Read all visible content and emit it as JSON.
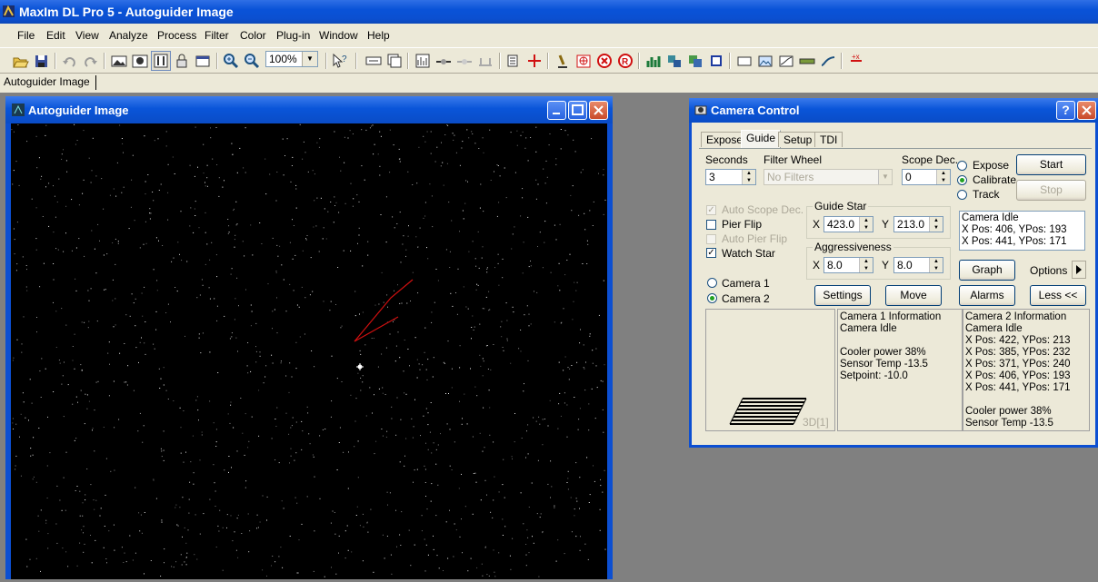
{
  "app": {
    "title": "MaxIm DL Pro 5 - Autoguider Image"
  },
  "menu": [
    "File",
    "Edit",
    "View",
    "Analyze",
    "Process",
    "Filter",
    "Color",
    "Plug-in",
    "Window",
    "Help"
  ],
  "toolbar": {
    "zoom_value": "100%",
    "icons": [
      "open-icon",
      "save-icon",
      "undo-icon",
      "redo-icon",
      "image-icon",
      "screen-stretch-icon",
      "autoguider-icon",
      "lock-icon",
      "settings-icon",
      "zoom-in-icon",
      "zoom-out-icon",
      "help-pointer-icon",
      "info-icon",
      "stack-icon",
      "histogram-icon",
      "line-profile-icon",
      "graph-icon",
      "measure-icon",
      "copy-icon",
      "crosshair-icon",
      "telescope-icon",
      "camera-icon",
      "stop-icon",
      "record-icon",
      "bar-chart-icon",
      "layers-icon",
      "overlay-icon",
      "frame-icon",
      "rect-icon",
      "photo-icon",
      "curve-icon",
      "filter-icon",
      "line-icon",
      "marker-icon"
    ]
  },
  "tabs": [
    "Autoguider Image"
  ],
  "image_window": {
    "title": "Autoguider Image"
  },
  "camera_control": {
    "title": "Camera Control",
    "tabs": [
      "Expose",
      "Guide",
      "Setup",
      "TDI"
    ],
    "active_tab": "Guide",
    "seconds_label": "Seconds",
    "seconds_value": "3",
    "filter_wheel_label": "Filter Wheel",
    "filter_wheel_value": "No Filters",
    "scope_dec_label": "Scope Dec.",
    "scope_dec_value": "0",
    "mode_options": [
      "Expose",
      "Calibrate",
      "Track"
    ],
    "mode_selected": "Calibrate",
    "start_label": "Start",
    "stop_label": "Stop",
    "auto_scope_dec": "Auto Scope Dec.",
    "pier_flip": "Pier Flip",
    "auto_pier_flip": "Auto Pier Flip",
    "watch_star": "Watch Star",
    "guide_star_label": "Guide Star",
    "guide_x_label": "X",
    "guide_x_value": "423.0",
    "guide_y_label": "Y",
    "guide_y_value": "213.0",
    "aggressiveness_label": "Aggressiveness",
    "aggr_x_label": "X",
    "aggr_x_value": "8.0",
    "aggr_y_label": "Y",
    "aggr_y_value": "8.0",
    "status_lines": [
      "Camera Idle",
      "X Pos: 406, YPos: 193",
      "X Pos: 441, YPos: 171"
    ],
    "camera1": "Camera 1",
    "camera2": "Camera 2",
    "camera_selected": "Camera 2",
    "settings_label": "Settings",
    "move_label": "Move",
    "graph_label": "Graph",
    "options_label": "Options",
    "alarms_label": "Alarms",
    "less_label": "Less <<",
    "preview_label": "3D[1]",
    "cam1_info": [
      "Camera 1 Information",
      "Camera Idle",
      "",
      "Cooler power 38%",
      "Sensor Temp -13.5",
      "Setpoint: -10.0"
    ],
    "cam2_info": [
      "Camera 2 Information",
      "Camera Idle",
      "X Pos: 422, YPos: 213",
      "X Pos: 385, YPos: 232",
      "X Pos: 371, YPos: 240",
      "X Pos: 406, YPos: 193",
      "X Pos: 441, YPos: 171",
      "",
      "Cooler power 38%",
      "Sensor Temp -13.5"
    ]
  },
  "colors": {
    "title_blue": "#0a55d9",
    "guide_trace": "#d01010"
  }
}
